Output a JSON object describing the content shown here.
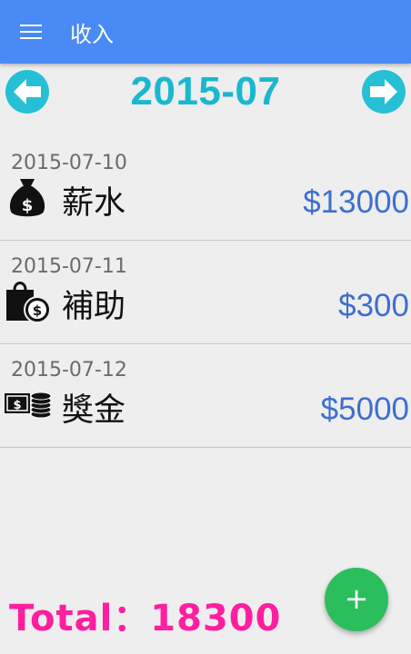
{
  "appbar": {
    "title": "收入",
    "menu_icon": "hamburger-icon"
  },
  "month": {
    "label": "2015-07",
    "prev_icon": "arrow-left-circle-icon",
    "next_icon": "arrow-right-circle-icon",
    "accent": "#1ab8cf"
  },
  "entries": [
    {
      "date": "2015-07-10",
      "name": "薪水",
      "amount": "$13000",
      "icon": "money-bag-icon"
    },
    {
      "date": "2015-07-11",
      "name": "補助",
      "amount": "$300",
      "icon": "shopping-bag-coin-icon"
    },
    {
      "date": "2015-07-12",
      "name": "獎金",
      "amount": "$5000",
      "icon": "cash-coins-icon"
    }
  ],
  "total": {
    "label": "Total：18300",
    "color": "#ff1ea0"
  },
  "fab": {
    "label": "+",
    "color": "#2bbe5c"
  },
  "colors": {
    "appbar": "#4a8af4",
    "amount": "#3e6fd0"
  }
}
